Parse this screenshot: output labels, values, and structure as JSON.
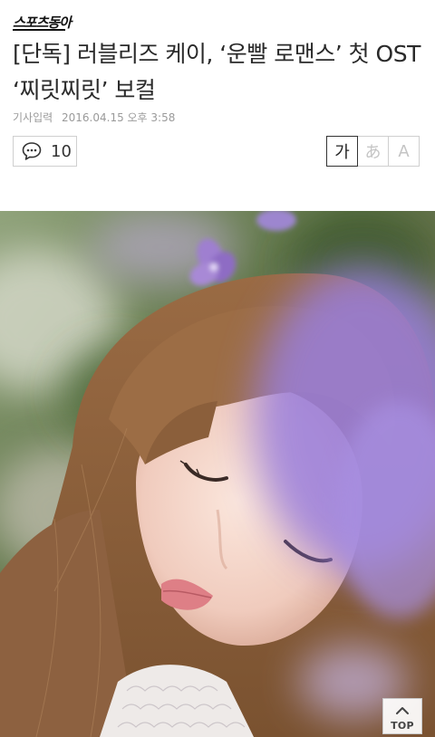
{
  "header": {
    "logo_text": "스포츠동아"
  },
  "article": {
    "headline": "[단독] 러블리즈 케이, ‘운빨 로맨스’ 첫 OST ‘찌릿찌릿’ 보컬",
    "meta_label": "기사입력",
    "published": "2016.04.15 오후 3:58"
  },
  "toolbar": {
    "comment_icon": "speech-bubble-icon",
    "comment_count": "10",
    "font_sizes": [
      "가",
      "あ",
      "A"
    ],
    "font_size_selected": "가"
  },
  "photo": {
    "description_icon": "article-photo"
  },
  "scroll_top": {
    "icon": "chevron-up-icon",
    "label": "TOP"
  },
  "colors": {
    "text": "#2a2a2a",
    "meta": "#9a9a9a",
    "border": "#cfcfcf",
    "active_border": "#333333"
  }
}
